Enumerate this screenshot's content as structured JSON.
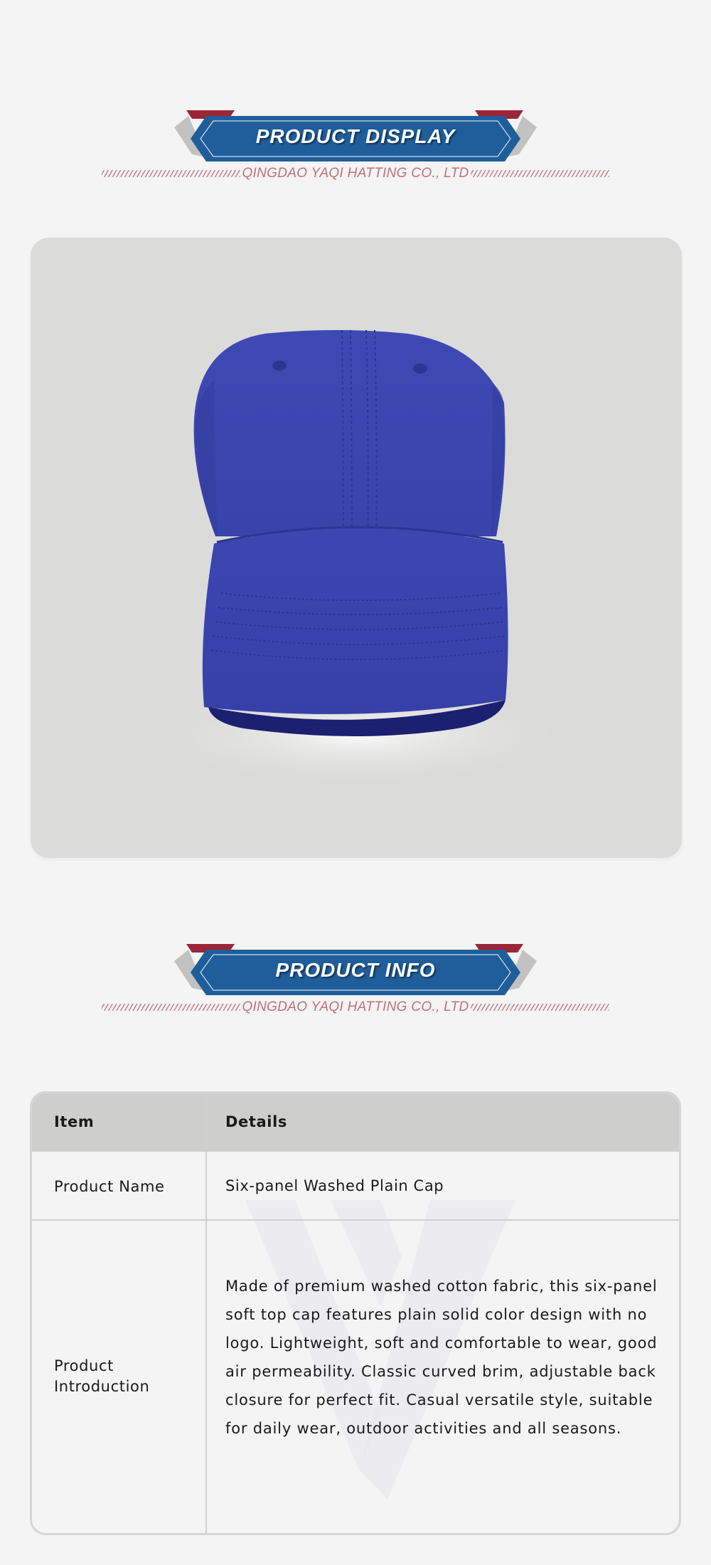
{
  "sections": {
    "display": {
      "title": "PRODUCT DISPLAY",
      "company": "QINGDAO YAQI HATTING CO., LTD"
    },
    "info": {
      "title": "PRODUCT INFO",
      "company": "QINGDAO YAQI HATTING CO., LTD"
    }
  },
  "product_image": {
    "subject": "blue six-panel washed cap",
    "cap_color": "#3b45b0",
    "background_color": "#dbdbd9"
  },
  "table": {
    "headers": {
      "item": "Item",
      "details": "Details"
    },
    "rows": [
      {
        "item": "Product Name",
        "details": "Six-panel Washed Plain Cap"
      },
      {
        "item": "Product Introduction",
        "details": "Made of premium washed cotton fabric, this six-panel soft top cap features plain solid color design with no logo. Lightweight, soft and comfortable to wear, good air permeability. Classic curved brim, adjustable back closure for perfect fit. Casual versatile style, suitable for daily wear, outdoor activities and all seasons."
      }
    ]
  },
  "colors": {
    "banner_blue": "#1f5e9a",
    "banner_red": "#9c2538",
    "banner_gray": "#c2c2c0",
    "company_text": "#c0707a"
  }
}
